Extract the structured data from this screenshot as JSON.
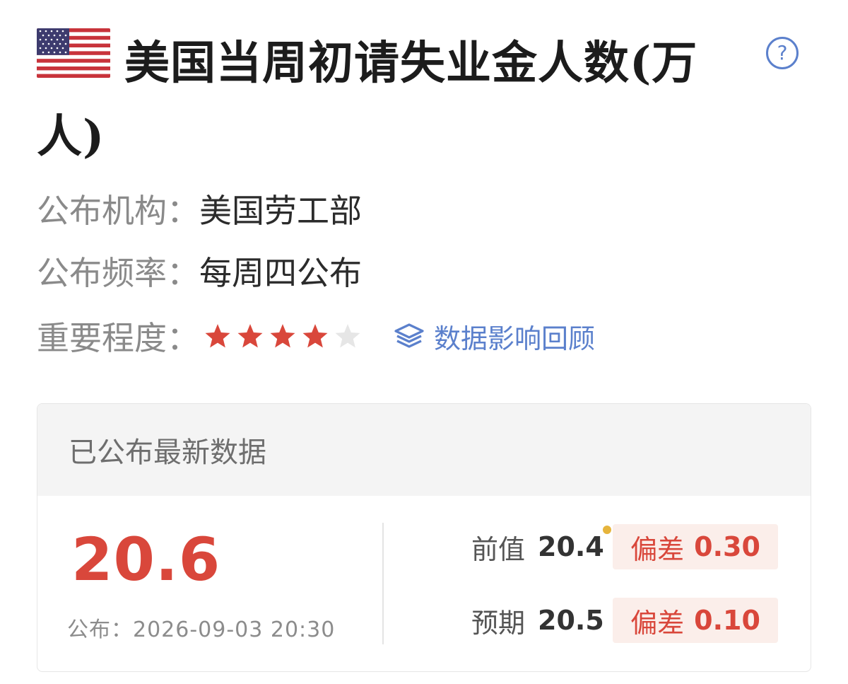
{
  "header": {
    "flag_icon": "us-flag-icon",
    "title": "美国当周初请失业金人数(万人)",
    "help_icon": "help-icon",
    "help_glyph": "?"
  },
  "info": {
    "publisher_label": "公布机构：",
    "publisher": "美国劳工部",
    "frequency_label": "公布频率：",
    "frequency": "每周四公布",
    "importance_label": "重要程度：",
    "importance_stars": 4,
    "importance_max": 5,
    "star_filled_color": "#d9473b",
    "star_empty_color": "#e6e6e6",
    "review_icon": "layers-icon",
    "review_link": "数据影响回顾"
  },
  "card": {
    "header": "已公布最新数据",
    "actual": "20.6",
    "published": "公布：2026-09-03 20:30",
    "previous": {
      "label": "前值",
      "value": "20.4",
      "deviation_label": "偏差",
      "deviation": "0.30"
    },
    "forecast": {
      "label": "预期",
      "value": "20.5",
      "deviation_label": "偏差",
      "deviation": "0.10"
    },
    "accent_color": "#d9473b",
    "revised_dot_color": "#e6b43c"
  }
}
